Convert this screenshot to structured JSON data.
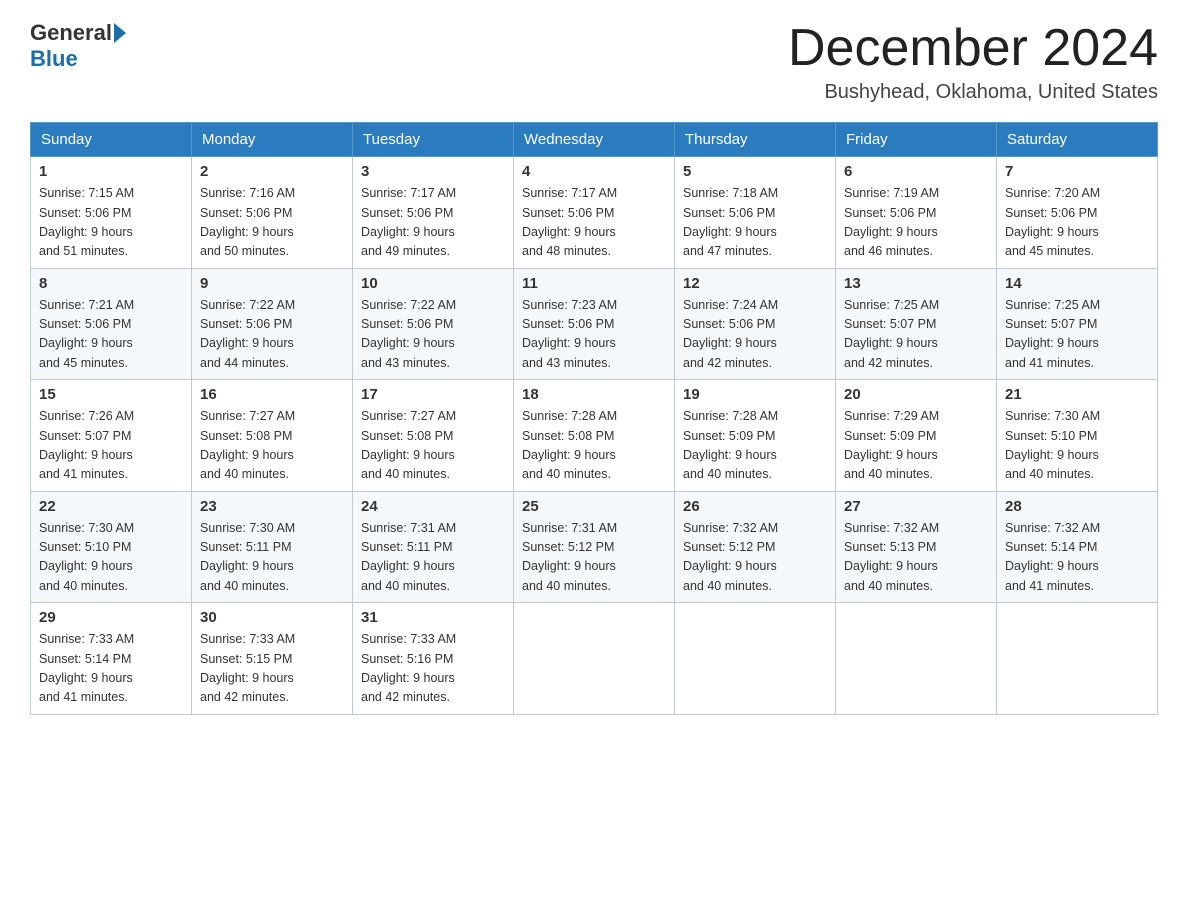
{
  "header": {
    "logo_general": "General",
    "logo_blue": "Blue",
    "month_title": "December 2024",
    "location": "Bushyhead, Oklahoma, United States"
  },
  "days_of_week": [
    "Sunday",
    "Monday",
    "Tuesday",
    "Wednesday",
    "Thursday",
    "Friday",
    "Saturday"
  ],
  "weeks": [
    [
      {
        "day": "1",
        "sunrise": "7:15 AM",
        "sunset": "5:06 PM",
        "daylight": "9 hours and 51 minutes."
      },
      {
        "day": "2",
        "sunrise": "7:16 AM",
        "sunset": "5:06 PM",
        "daylight": "9 hours and 50 minutes."
      },
      {
        "day": "3",
        "sunrise": "7:17 AM",
        "sunset": "5:06 PM",
        "daylight": "9 hours and 49 minutes."
      },
      {
        "day": "4",
        "sunrise": "7:17 AM",
        "sunset": "5:06 PM",
        "daylight": "9 hours and 48 minutes."
      },
      {
        "day": "5",
        "sunrise": "7:18 AM",
        "sunset": "5:06 PM",
        "daylight": "9 hours and 47 minutes."
      },
      {
        "day": "6",
        "sunrise": "7:19 AM",
        "sunset": "5:06 PM",
        "daylight": "9 hours and 46 minutes."
      },
      {
        "day": "7",
        "sunrise": "7:20 AM",
        "sunset": "5:06 PM",
        "daylight": "9 hours and 45 minutes."
      }
    ],
    [
      {
        "day": "8",
        "sunrise": "7:21 AM",
        "sunset": "5:06 PM",
        "daylight": "9 hours and 45 minutes."
      },
      {
        "day": "9",
        "sunrise": "7:22 AM",
        "sunset": "5:06 PM",
        "daylight": "9 hours and 44 minutes."
      },
      {
        "day": "10",
        "sunrise": "7:22 AM",
        "sunset": "5:06 PM",
        "daylight": "9 hours and 43 minutes."
      },
      {
        "day": "11",
        "sunrise": "7:23 AM",
        "sunset": "5:06 PM",
        "daylight": "9 hours and 43 minutes."
      },
      {
        "day": "12",
        "sunrise": "7:24 AM",
        "sunset": "5:06 PM",
        "daylight": "9 hours and 42 minutes."
      },
      {
        "day": "13",
        "sunrise": "7:25 AM",
        "sunset": "5:07 PM",
        "daylight": "9 hours and 42 minutes."
      },
      {
        "day": "14",
        "sunrise": "7:25 AM",
        "sunset": "5:07 PM",
        "daylight": "9 hours and 41 minutes."
      }
    ],
    [
      {
        "day": "15",
        "sunrise": "7:26 AM",
        "sunset": "5:07 PM",
        "daylight": "9 hours and 41 minutes."
      },
      {
        "day": "16",
        "sunrise": "7:27 AM",
        "sunset": "5:08 PM",
        "daylight": "9 hours and 40 minutes."
      },
      {
        "day": "17",
        "sunrise": "7:27 AM",
        "sunset": "5:08 PM",
        "daylight": "9 hours and 40 minutes."
      },
      {
        "day": "18",
        "sunrise": "7:28 AM",
        "sunset": "5:08 PM",
        "daylight": "9 hours and 40 minutes."
      },
      {
        "day": "19",
        "sunrise": "7:28 AM",
        "sunset": "5:09 PM",
        "daylight": "9 hours and 40 minutes."
      },
      {
        "day": "20",
        "sunrise": "7:29 AM",
        "sunset": "5:09 PM",
        "daylight": "9 hours and 40 minutes."
      },
      {
        "day": "21",
        "sunrise": "7:30 AM",
        "sunset": "5:10 PM",
        "daylight": "9 hours and 40 minutes."
      }
    ],
    [
      {
        "day": "22",
        "sunrise": "7:30 AM",
        "sunset": "5:10 PM",
        "daylight": "9 hours and 40 minutes."
      },
      {
        "day": "23",
        "sunrise": "7:30 AM",
        "sunset": "5:11 PM",
        "daylight": "9 hours and 40 minutes."
      },
      {
        "day": "24",
        "sunrise": "7:31 AM",
        "sunset": "5:11 PM",
        "daylight": "9 hours and 40 minutes."
      },
      {
        "day": "25",
        "sunrise": "7:31 AM",
        "sunset": "5:12 PM",
        "daylight": "9 hours and 40 minutes."
      },
      {
        "day": "26",
        "sunrise": "7:32 AM",
        "sunset": "5:12 PM",
        "daylight": "9 hours and 40 minutes."
      },
      {
        "day": "27",
        "sunrise": "7:32 AM",
        "sunset": "5:13 PM",
        "daylight": "9 hours and 40 minutes."
      },
      {
        "day": "28",
        "sunrise": "7:32 AM",
        "sunset": "5:14 PM",
        "daylight": "9 hours and 41 minutes."
      }
    ],
    [
      {
        "day": "29",
        "sunrise": "7:33 AM",
        "sunset": "5:14 PM",
        "daylight": "9 hours and 41 minutes."
      },
      {
        "day": "30",
        "sunrise": "7:33 AM",
        "sunset": "5:15 PM",
        "daylight": "9 hours and 42 minutes."
      },
      {
        "day": "31",
        "sunrise": "7:33 AM",
        "sunset": "5:16 PM",
        "daylight": "9 hours and 42 minutes."
      },
      null,
      null,
      null,
      null
    ]
  ],
  "labels": {
    "sunrise": "Sunrise:",
    "sunset": "Sunset:",
    "daylight": "Daylight:"
  }
}
